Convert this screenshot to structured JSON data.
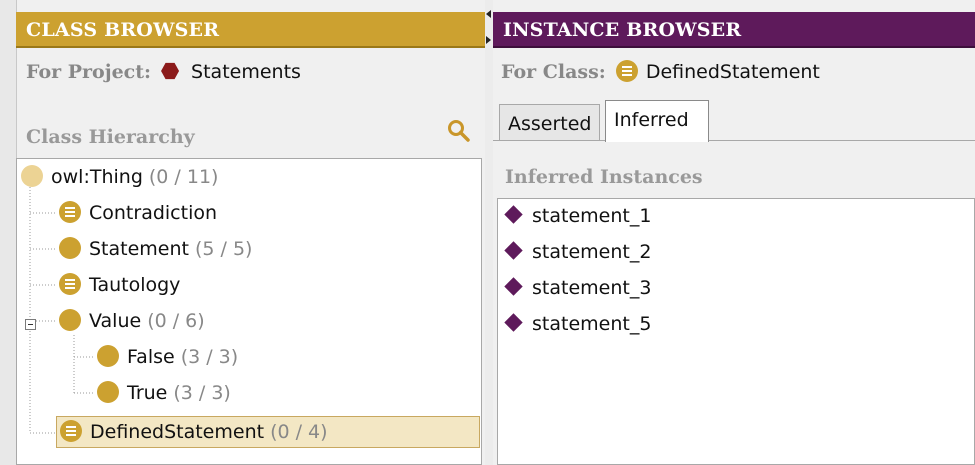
{
  "class_browser": {
    "title": "CLASS BROWSER",
    "for_label": "For Project:",
    "project_name": "Statements",
    "hierarchy_title": "Class Hierarchy",
    "tree": [
      {
        "label": "owl:Thing",
        "count": "(0 / 11)"
      },
      {
        "label": "Contradiction",
        "count": ""
      },
      {
        "label": "Statement",
        "count": "(5 / 5)"
      },
      {
        "label": "Tautology",
        "count": ""
      },
      {
        "label": "Value",
        "count": "(0 / 6)"
      },
      {
        "label": "False",
        "count": "(3 / 3)"
      },
      {
        "label": "True",
        "count": "(3 / 3)"
      },
      {
        "label": "DefinedStatement",
        "count": "(0 / 4)"
      }
    ]
  },
  "instance_browser": {
    "title": "INSTANCE BROWSER",
    "for_label": "For Class:",
    "class_name": "DefinedStatement",
    "tabs": [
      {
        "label": "Asserted"
      },
      {
        "label": "Inferred"
      }
    ],
    "active_tab": "Inferred",
    "section_title": "Inferred Instances",
    "instances": [
      "statement_1",
      "statement_2",
      "statement_3",
      "statement_5"
    ]
  },
  "colors": {
    "class_accent": "#cca130",
    "instance_accent": "#5e1a5b",
    "project_icon": "#8b1a1a"
  },
  "icons": {
    "project": "project-hexagon-icon",
    "class_defined": "defined-class-icon",
    "class_primitive": "primitive-class-icon",
    "instance": "instance-diamond-icon",
    "find": "find-class-icon",
    "delete": "delete-instance-icon"
  }
}
